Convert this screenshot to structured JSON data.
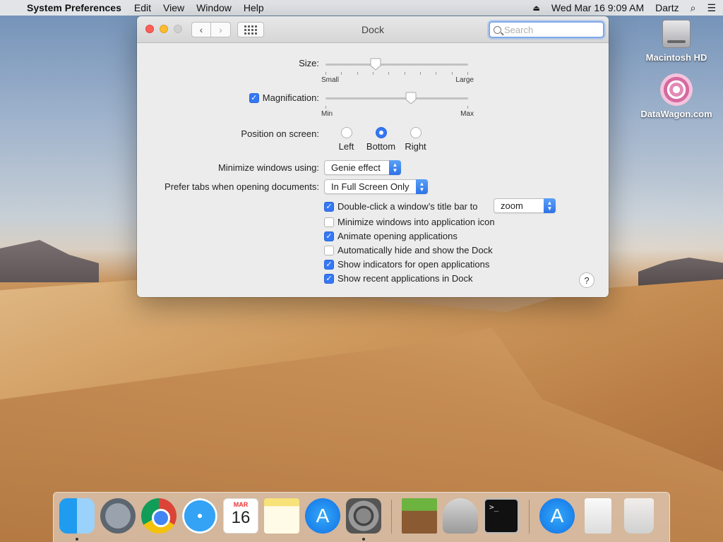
{
  "menubar": {
    "app_name": "System Preferences",
    "items": [
      "Edit",
      "View",
      "Window",
      "Help"
    ],
    "datetime": "Wed Mar 16  9:09 AM",
    "user": "Dartz"
  },
  "desktop": {
    "hd_label": "Macintosh HD",
    "datawagon_label": "DataWagon.com"
  },
  "window": {
    "title": "Dock",
    "search_placeholder": "Search"
  },
  "dock_prefs": {
    "size": {
      "label": "Size:",
      "min_label": "Small",
      "max_label": "Large",
      "value": 0.35
    },
    "magnification": {
      "label": "Magnification:",
      "checked": true,
      "min_label": "Min",
      "max_label": "Max",
      "value": 0.6
    },
    "position": {
      "label": "Position on screen:",
      "options": [
        "Left",
        "Bottom",
        "Right"
      ],
      "selected": "Bottom"
    },
    "minimize_using": {
      "label": "Minimize windows using:",
      "value": "Genie effect"
    },
    "prefer_tabs": {
      "label": "Prefer tabs when opening documents:",
      "value": "In Full Screen Only"
    },
    "double_click": {
      "label": "Double-click a window’s title bar to",
      "checked": true,
      "value": "zoom"
    },
    "checkboxes": [
      {
        "label": "Minimize windows into application icon",
        "checked": false
      },
      {
        "label": "Animate opening applications",
        "checked": true
      },
      {
        "label": "Automatically hide and show the Dock",
        "checked": false
      },
      {
        "label": "Show indicators for open applications",
        "checked": true
      },
      {
        "label": "Show recent applications in Dock",
        "checked": true
      }
    ],
    "help_label": "?"
  },
  "dock": {
    "calendar_month": "MAR",
    "calendar_day": "16",
    "terminal_prompt": ">_"
  }
}
